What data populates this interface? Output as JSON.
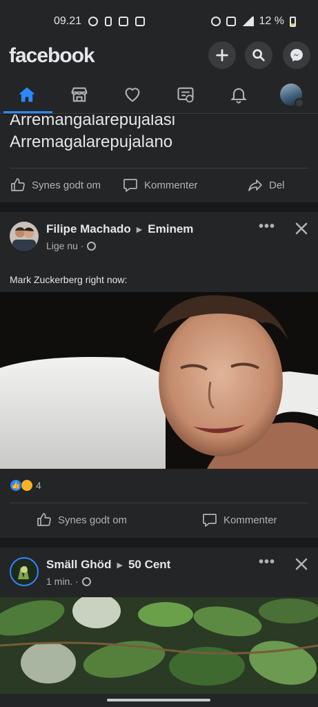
{
  "status_bar": {
    "time": "09.21",
    "battery": "12 %"
  },
  "header": {
    "logo": "facebook",
    "buttons": [
      {
        "name": "create",
        "icon": "plus-icon"
      },
      {
        "name": "search",
        "icon": "search-icon"
      },
      {
        "name": "messenger",
        "icon": "messenger-icon"
      }
    ]
  },
  "tabs": [
    {
      "name": "home",
      "icon": "home-icon",
      "active": true
    },
    {
      "name": "marketplace",
      "icon": "store-icon"
    },
    {
      "name": "dating",
      "icon": "heart-icon"
    },
    {
      "name": "news",
      "icon": "news-icon"
    },
    {
      "name": "notifications",
      "icon": "bell-icon"
    },
    {
      "name": "menu",
      "icon": "avatar"
    }
  ],
  "post1": {
    "text_line1": "Arremangalarepujalasi",
    "text_line2": "Arremagalarepujalano",
    "actions": {
      "like": "Synes godt om",
      "comment": "Kommenter",
      "share": "Del"
    }
  },
  "post2": {
    "author": "Filipe Machado",
    "target": "Eminem",
    "time": "Lige nu ·",
    "caption": "Mark Zuckerberg right now:",
    "reaction_count": "4",
    "actions": {
      "like": "Synes godt om",
      "comment": "Kommenter"
    }
  },
  "post3": {
    "author": "Smäll Ghöd",
    "target": "50 Cent",
    "time": "1 min. ·"
  },
  "colors": {
    "background": "#18191a",
    "card": "#242526",
    "accent": "#2d88ff",
    "text_primary": "#e4e6eb",
    "text_secondary": "#b0b3b8"
  }
}
